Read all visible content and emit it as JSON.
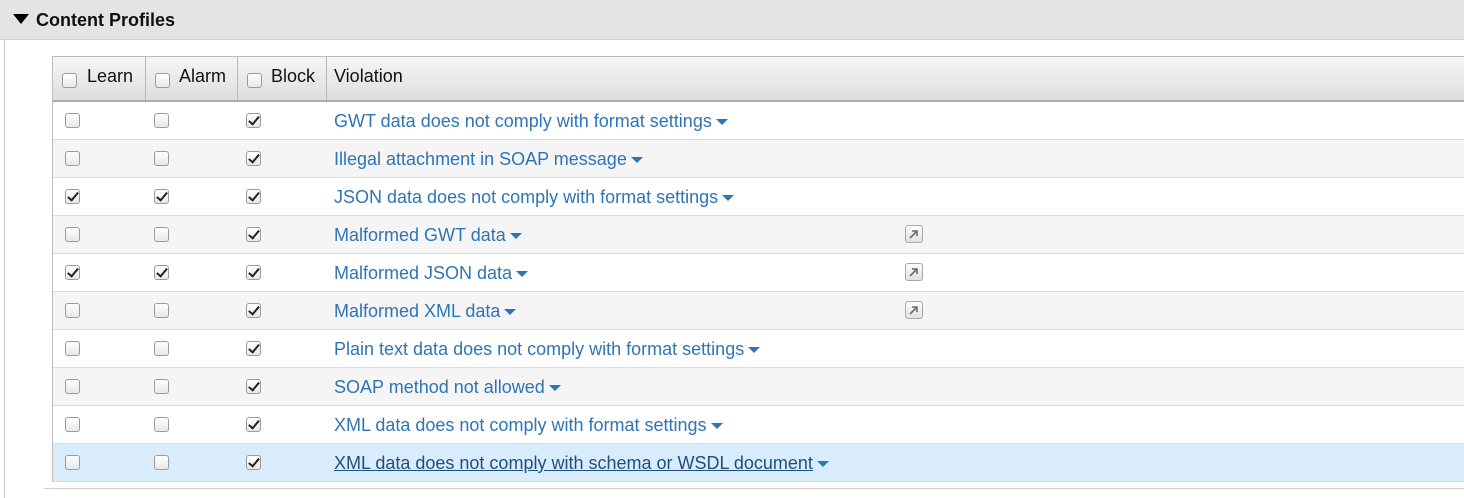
{
  "section": {
    "title": "Content Profiles",
    "collapse_icon": "triangle-down-icon"
  },
  "table": {
    "columns": {
      "learn": "Learn",
      "alarm": "Alarm",
      "block": "Block",
      "violation": "Violation"
    },
    "header_checks": {
      "learn": false,
      "alarm": false,
      "block": false
    },
    "rows": [
      {
        "violation": "GWT data does not comply with format settings",
        "learn": false,
        "alarm": false,
        "block": true,
        "has_open_icon": false
      },
      {
        "violation": "Illegal attachment in SOAP message",
        "learn": false,
        "alarm": false,
        "block": true,
        "has_open_icon": false
      },
      {
        "violation": "JSON data does not comply with format settings",
        "learn": true,
        "alarm": true,
        "block": true,
        "has_open_icon": false
      },
      {
        "violation": "Malformed GWT data",
        "learn": false,
        "alarm": false,
        "block": true,
        "has_open_icon": true
      },
      {
        "violation": "Malformed JSON data",
        "learn": true,
        "alarm": true,
        "block": true,
        "has_open_icon": true
      },
      {
        "violation": "Malformed XML data",
        "learn": false,
        "alarm": false,
        "block": true,
        "has_open_icon": true
      },
      {
        "violation": "Plain text data does not comply with format settings",
        "learn": false,
        "alarm": false,
        "block": true,
        "has_open_icon": false
      },
      {
        "violation": "SOAP method not allowed",
        "learn": false,
        "alarm": false,
        "block": true,
        "has_open_icon": false
      },
      {
        "violation": "XML data does not comply with format settings",
        "learn": false,
        "alarm": false,
        "block": true,
        "has_open_icon": false
      },
      {
        "violation": "XML data does not comply with schema or WSDL document",
        "learn": false,
        "alarm": false,
        "block": true,
        "has_open_icon": false,
        "selected": true
      }
    ]
  },
  "colors": {
    "link": "#2f74b5",
    "selected_row": "#d9ecfb",
    "header_bg": "#e4e4e4"
  }
}
